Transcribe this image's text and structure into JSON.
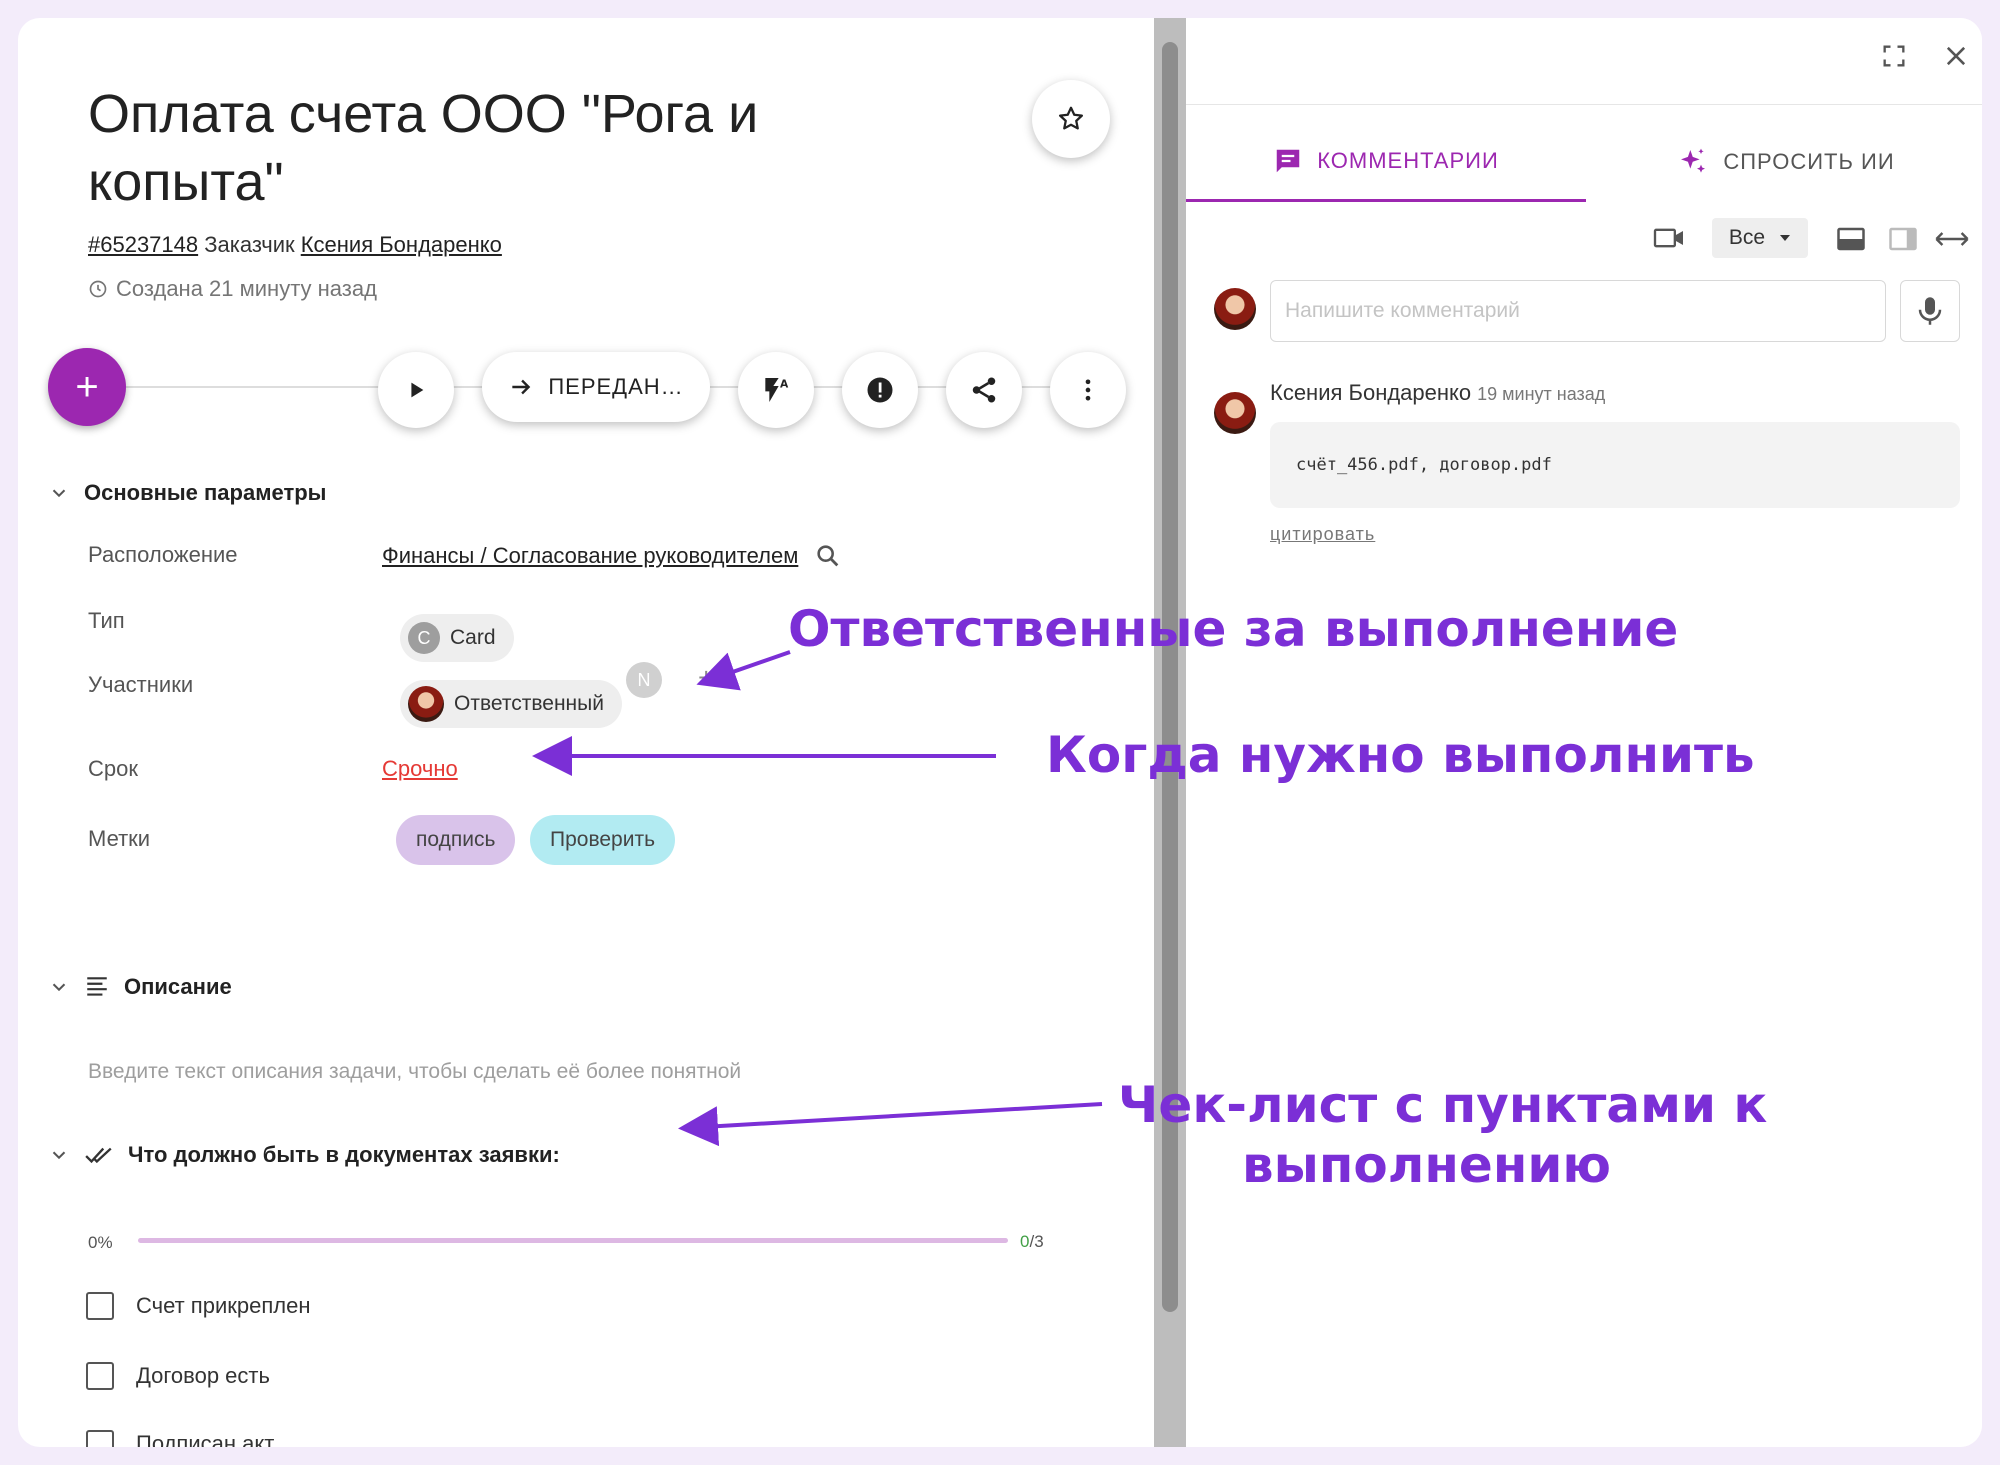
{
  "task": {
    "title": "Оплата счета ООО \"Рога и копыта\"",
    "number": "#65237148",
    "customer_label": "Заказчик",
    "customer_name": "Ксения Бондаренко",
    "created": "Создана 21 минуту назад"
  },
  "toolbar": {
    "add": "+",
    "pass_label": "ПЕРЕДАН…"
  },
  "sections": {
    "main": "Основные параметры",
    "description": "Описание",
    "checklist": "Что должно быть в документах заявки:"
  },
  "params": {
    "location_label": "Расположение",
    "location_value": "Финансы / Согласование руководителем",
    "type_label": "Тип",
    "type_chip_letter": "C",
    "type_value": "Card",
    "participants_label": "Участники",
    "participant_role": "Ответственный",
    "participant_extra": "N",
    "participant_add": "+",
    "due_label": "Срок",
    "due_value": "Срочно",
    "tags_label": "Метки",
    "tags": [
      {
        "text": "подпись",
        "color": "#d9c3ea"
      },
      {
        "text": "Проверить",
        "color": "#b2ebf2"
      }
    ]
  },
  "description": {
    "placeholder": "Введите текст описания задачи, чтобы сделать её более понятной"
  },
  "checklist": {
    "percent_text": "0%",
    "progress": 0,
    "done": "0",
    "total": "/3",
    "items": [
      "Счет прикреплен",
      "Договор есть",
      "Подписан акт"
    ]
  },
  "comments_panel": {
    "tab_comments": "КОММЕНТАРИИ",
    "tab_ai": "СПРОСИТЬ ИИ",
    "filter_value": "Все",
    "input_placeholder": "Напишите комментарий",
    "comment": {
      "author": "Ксения Бондаренко",
      "time": "19 минут назад",
      "attachments": "счёт_456.pdf, договор.pdf",
      "quote_label": "цитировать"
    }
  },
  "annotations": {
    "responsible": "Ответственные за выполнение",
    "deadline": "Когда нужно выполнить",
    "checklist_line1": "Чек-лист с пунктами к",
    "checklist_line2": "выполнению"
  },
  "colors": {
    "accent": "#9c27b0",
    "annotation": "#7b2fd6",
    "urgent": "#e53935"
  }
}
